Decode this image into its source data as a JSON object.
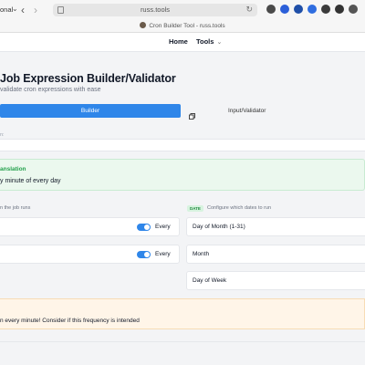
{
  "browser": {
    "profile_label": "onal",
    "url": "russ.tools",
    "tab_title": "Cron Builder Tool - russ.tools"
  },
  "nav": {
    "home": "Home",
    "tools": "Tools"
  },
  "page": {
    "title": "Job Expression Builder/Validator",
    "subtitle": "validate cron expressions with ease"
  },
  "tabs": {
    "builder": "Builder",
    "input": "Input/Validator"
  },
  "expression_label": "n:",
  "translation": {
    "label": "anslation",
    "text": "y minute of every day"
  },
  "time_section": {
    "hint": "n the job runs"
  },
  "date_section": {
    "badge": "DATE",
    "hint": "Configure which dates to run"
  },
  "time_fields": [
    {
      "toggle_on": true,
      "value": "Every"
    },
    {
      "toggle_on": true,
      "value": "Every"
    }
  ],
  "date_fields": [
    "Day of Month (1-31)",
    "Month",
    "Day of Week"
  ],
  "warning": {
    "text": "n every minute! Consider if this frequency is intended"
  },
  "colors": {
    "accent": "#2f86e9",
    "success": "#22a04b",
    "warning_bg": "#fff5e8"
  }
}
